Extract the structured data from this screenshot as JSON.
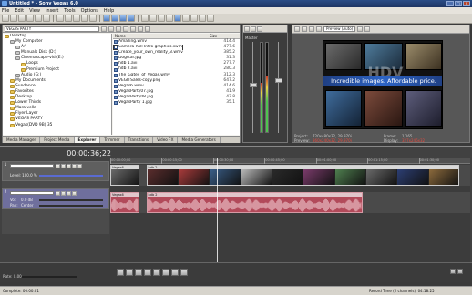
{
  "window": {
    "title": "Untitled * - Sony Vegas 6.0"
  },
  "menu": [
    "File",
    "Edit",
    "View",
    "Insert",
    "Tools",
    "Options",
    "Help"
  ],
  "explorer": {
    "path": "VEGAS PARTY",
    "tree": [
      {
        "label": "Desktop",
        "indent": 0
      },
      {
        "label": "My Computer",
        "indent": 1
      },
      {
        "label": "A:\\",
        "indent": 2
      },
      {
        "label": "Manuals Disk (D:)",
        "indent": 2
      },
      {
        "label": "Cinemascape-vid (E:)",
        "indent": 2
      },
      {
        "label": "Loops",
        "indent": 3
      },
      {
        "label": "Premium Project",
        "indent": 3
      },
      {
        "label": "Audio (G:)",
        "indent": 2
      },
      {
        "label": "My Documents",
        "indent": 1
      },
      {
        "label": "Sundance",
        "indent": 1
      },
      {
        "label": "Favorites",
        "indent": 1
      },
      {
        "label": "Desktop",
        "indent": 1
      },
      {
        "label": "Lower Thirds",
        "indent": 1
      },
      {
        "label": "Mara-vella",
        "indent": 1
      },
      {
        "label": "Flyer-Layer",
        "indent": 1
      },
      {
        "label": "VEGAS PARTY",
        "indent": 1
      },
      {
        "label": "Vegas(DVD 9B) 35",
        "indent": 1
      }
    ],
    "columns": {
      "name": "Name",
      "size": "Size"
    },
    "files": [
      {
        "name": "Amazing.wmv",
        "size": "414.4"
      },
      {
        "name": "Camera Roll Intro graphics.swm",
        "size": "477.6"
      },
      {
        "name": "Create_your_own_reality_3.wmv",
        "size": "385.2"
      },
      {
        "name": "Dogstar.jpg",
        "size": "31.3"
      },
      {
        "name": "hdb 1.avi",
        "size": "277.7"
      },
      {
        "name": "hdb 2.avi",
        "size": "280.3"
      },
      {
        "name": "The_Gates_of_Vegas.wmv",
        "size": "312.3"
      },
      {
        "name": "VEGITSales-copy.png",
        "size": "647.2"
      },
      {
        "name": "Vegas6.wmv",
        "size": "414.6"
      },
      {
        "name": "VegasParty07.jpg",
        "size": "41.9"
      },
      {
        "name": "VegasParty08.jpg",
        "size": "43.8"
      },
      {
        "name": "VegasParty 1.jpg",
        "size": "35.1"
      }
    ],
    "tabs": [
      "Media Manager",
      "Project Media",
      "Explorer",
      "Trimmer",
      "Transitions",
      "Video FX",
      "Media Generators"
    ],
    "active_tab": "Explorer"
  },
  "mixer": {
    "label": "Master",
    "left_level": 0.55,
    "right_level": 0.62
  },
  "preview": {
    "mode": "Preview (Auto)",
    "banner_text": "Incredible images. Affordable price.",
    "watermark": "HDV",
    "project_label": "Project:",
    "project_value": "720x480x32, 29.970i",
    "preview_label": "Preview:",
    "preview_value": "360x240x32, 29.970i",
    "frame_label": "Frame:",
    "frame_value": "1,165",
    "display_label": "Display:",
    "display_value": "327x246x32"
  },
  "timeline": {
    "time": "00:00:36;22",
    "video_track": {
      "number": "1",
      "level_label": "Level: 100.0 %",
      "ruler_marks": [
        "00:00:00;00",
        "00:00:15;00",
        "00:00:30;00",
        "00:00:45;00",
        "00:01:00;00",
        "00:01:15;00",
        "00:01:30;00"
      ]
    },
    "audio_track": {
      "number": "2",
      "vol_label": "Vol:",
      "vol_value": "0.0 dB",
      "pan_label": "Pan:",
      "pan_value": "Center"
    },
    "video_clips": [
      {
        "label": "Vegas6",
        "start": 0.0,
        "end": 0.08
      },
      {
        "label": "hdb 2",
        "start": 0.1,
        "end": 0.97
      }
    ],
    "audio_clips": [
      {
        "label": "Vegas6",
        "start": 0.0,
        "end": 0.08
      },
      {
        "label": "hdb 2",
        "start": 0.1,
        "end": 0.7
      }
    ]
  },
  "transport": {
    "rate": "Rate: 0.00"
  },
  "status": {
    "left": "Complete: 00:00:01",
    "right": "Record Time (2 channels): 04:18:25"
  },
  "colors": {
    "accent": "#2d64c5",
    "audio_clip": "#b24a5a",
    "track_audio": "#6f6f9d"
  }
}
